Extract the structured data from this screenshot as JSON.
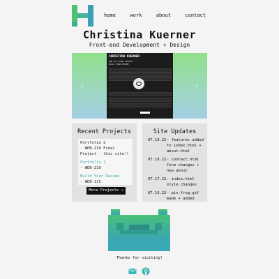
{
  "nav": {
    "links": [
      "home",
      "work",
      "about",
      "contact"
    ],
    "logo_colors": [
      "#48c06f",
      "#3fa4b0"
    ]
  },
  "header": {
    "name": "Christina Kuerner",
    "subtitle": "Front-end Development + Design"
  },
  "carousel": {
    "prev_icon": "chevron-left-icon",
    "next_icon": "chevron-right-icon",
    "slide": {
      "title": "CHRISTINA KUERNER",
      "heading_line1": "WEB-210 FINAL PROJECT",
      "heading_line2": "BUILD YOUR RESUME"
    }
  },
  "recent_projects": {
    "title": "Recent Projects",
    "items": [
      {
        "title": "Portfolio 2",
        "meta": "- WEB-210 Final Project - this site!!"
      },
      {
        "title": "Portfolio 1",
        "meta": "- WEB-210"
      },
      {
        "title": "Build Your Resume",
        "meta": "- WEB-115"
      }
    ],
    "button_label": "More Projects →"
  },
  "site_updates": {
    "title": "Site Updates",
    "items": [
      {
        "date": "07.19.22",
        "text": "- features added to index.html + about.html"
      },
      {
        "date": "07.18.22",
        "text": "- contact.html form changes + new about"
      },
      {
        "date": "07.17.22",
        "text": "- index.html style changes"
      },
      {
        "date": "07.16.22",
        "text": "- pix-frog.gif made + added"
      }
    ]
  },
  "footer": {
    "thanks": "Thanks for visiting!",
    "icons": [
      "email-icon",
      "github-icon"
    ],
    "accent": "#35b7b6"
  }
}
